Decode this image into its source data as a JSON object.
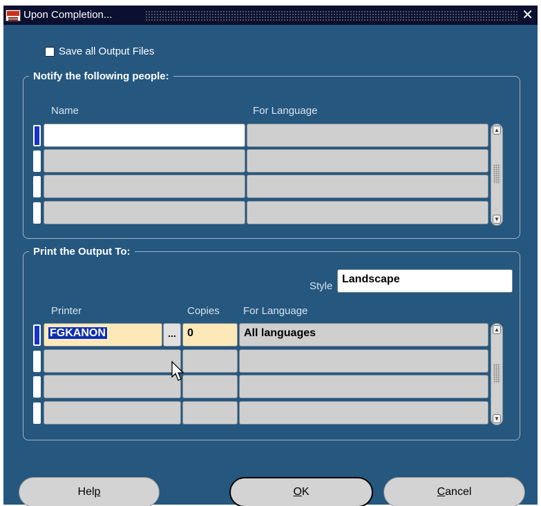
{
  "window": {
    "title": "Upon Completion...",
    "close_glyph": "✕",
    "icon": "oracle-app-icon"
  },
  "save_output": {
    "label": "Save all Output Files",
    "checked": false
  },
  "notify": {
    "legend": "Notify the following people:",
    "col_name": "Name",
    "col_language": "For Language",
    "rows": [
      {
        "name": "",
        "language": ""
      },
      {
        "name": "",
        "language": ""
      },
      {
        "name": "",
        "language": ""
      },
      {
        "name": "",
        "language": ""
      }
    ]
  },
  "print": {
    "legend": "Print the Output To:",
    "style_label": "Style",
    "style_value": "Landscape",
    "col_printer": "Printer",
    "col_copies": "Copies",
    "col_language": "For Language",
    "lov_label": "...",
    "rows": [
      {
        "printer": "FGKANON",
        "copies": "0",
        "language": "All languages"
      },
      {
        "printer": "",
        "copies": "",
        "language": ""
      },
      {
        "printer": "",
        "copies": "",
        "language": ""
      },
      {
        "printer": "",
        "copies": "",
        "language": ""
      }
    ]
  },
  "buttons": {
    "help_pre": "Hel",
    "help_u": "p",
    "help_post": "",
    "ok_pre": "",
    "ok_u": "O",
    "ok_post": "K",
    "cancel_pre": "",
    "cancel_u": "C",
    "cancel_post": "ancel"
  },
  "colors": {
    "dialog_bg": "#25577f",
    "titlebar_bg": "#0b0f30",
    "selection": "#0f2fb0",
    "active_cell": "#fde8b8"
  }
}
